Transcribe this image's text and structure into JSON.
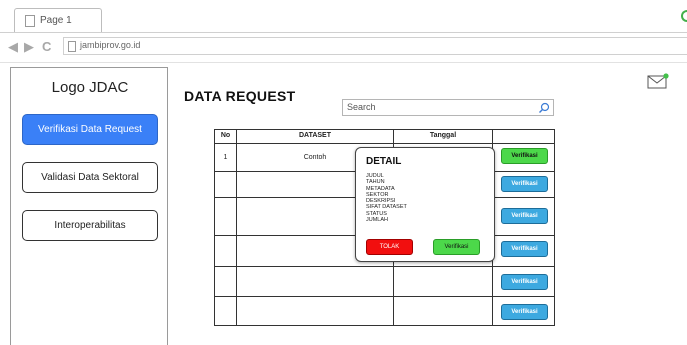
{
  "browser": {
    "tab_title": "Page 1",
    "url": "jambiprov.go.id"
  },
  "sidebar": {
    "logo": "Logo JDAC",
    "items": [
      {
        "label": "Verifikasi Data Request",
        "active": true
      },
      {
        "label": "Validasi Data Sektoral",
        "active": false
      },
      {
        "label": "Interoperabilitas",
        "active": false
      }
    ]
  },
  "main": {
    "title": "DATA REQUEST",
    "search_placeholder": "Search"
  },
  "table": {
    "headers": {
      "no": "No",
      "dataset": "DATASET",
      "tanggal": "Tanggal"
    },
    "rows": [
      {
        "no": "1",
        "dataset": "Contoh",
        "tanggal": "",
        "action": "Verifikasi"
      },
      {
        "no": "",
        "dataset": "",
        "tanggal": "",
        "action": "Verifikasi"
      },
      {
        "no": "",
        "dataset": "",
        "tanggal": "",
        "action": "Verifikasi"
      },
      {
        "no": "",
        "dataset": "",
        "tanggal": "",
        "action": "Verifikasi"
      },
      {
        "no": "",
        "dataset": "",
        "tanggal": "",
        "action": "Verifikasi"
      },
      {
        "no": "",
        "dataset": "",
        "tanggal": "",
        "action": "Verifikasi"
      }
    ]
  },
  "popup": {
    "title": "DETAIL",
    "fields": [
      "JUDUL",
      "TAHUN",
      "METADATA",
      "SEKTOR",
      "DESKRIPSI",
      "SIFAT DATASET",
      "STATUS",
      "JUMLAH"
    ],
    "reject_label": "TOLAK",
    "verify_label": "Verifikasi"
  },
  "colors": {
    "active_nav": "#3a80f7",
    "verify_blue": "#3da9e0",
    "verify_green": "#4cd84a",
    "reject_red": "#f20f0f"
  },
  "icons": [
    "page-icon",
    "back-arrow-icon",
    "forward-arrow-icon",
    "refresh-icon",
    "search-icon",
    "mail-icon",
    "loading-icon"
  ]
}
